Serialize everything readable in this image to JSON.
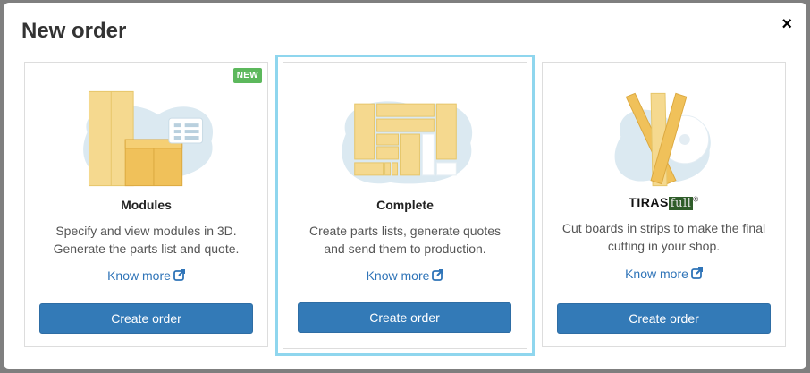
{
  "modal": {
    "title": "New order",
    "close_label": "×"
  },
  "cards": [
    {
      "title": "Modules",
      "badge": "NEW",
      "description_line1": "Specify and view modules in 3D.",
      "description_line2": "Generate the parts list and quote.",
      "know_more": "Know more",
      "button": "Create order"
    },
    {
      "title": "Complete",
      "description_line1": "Create parts lists, generate quotes",
      "description_line2": "and send them to production.",
      "know_more": "Know more",
      "button": "Create order",
      "selected": true
    },
    {
      "brand_part1": "TIRAS",
      "brand_part2": "full",
      "brand_mark": "®",
      "description_line1": "Cut boards in strips to make the final",
      "description_line2": "cutting in your shop.",
      "know_more": "Know more",
      "button": "Create order"
    }
  ],
  "colors": {
    "primary": "#337ab7",
    "link": "#2f74b8",
    "badge": "#5cb85c",
    "selected_border": "#8fd6ee",
    "wood": "#f2d48a",
    "blob": "#dbe9f1"
  },
  "icons": {
    "close": "close-icon",
    "external_link": "external-link-icon"
  }
}
